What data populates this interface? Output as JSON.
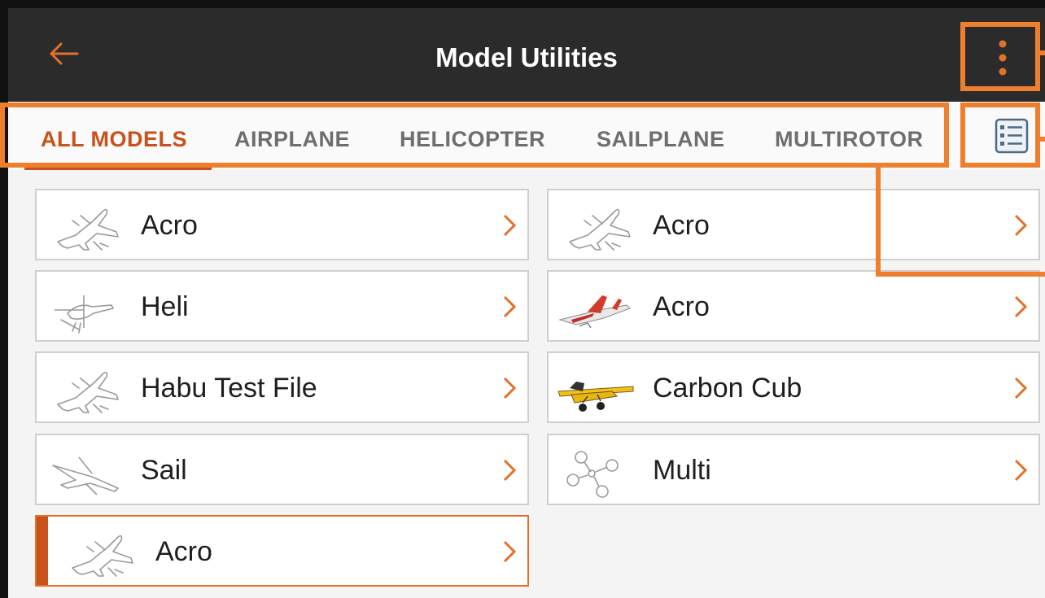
{
  "header": {
    "title": "Model Utilities",
    "back_icon": "arrow-left-icon",
    "menu_icon": "more-vertical-icon"
  },
  "tabs": [
    {
      "label": "ALL MODELS",
      "active": true
    },
    {
      "label": "AIRPLANE",
      "active": false
    },
    {
      "label": "HELICOPTER",
      "active": false
    },
    {
      "label": "SAILPLANE",
      "active": false
    },
    {
      "label": "MULTIROTOR",
      "active": false
    }
  ],
  "view_toggle_icon": "list-view-icon",
  "models": [
    {
      "name": "Acro",
      "thumbnail": "airplane-outline-icon"
    },
    {
      "name": "Acro",
      "thumbnail": "airplane-outline-icon"
    },
    {
      "name": "Heli",
      "thumbnail": "helicopter-outline-icon"
    },
    {
      "name": "Acro",
      "thumbnail": "jet-photo-thumbnail"
    },
    {
      "name": "Habu Test File",
      "thumbnail": "airplane-outline-icon"
    },
    {
      "name": "Carbon Cub",
      "thumbnail": "cub-photo-thumbnail"
    },
    {
      "name": "Sail",
      "thumbnail": "sailplane-outline-icon"
    },
    {
      "name": "Multi",
      "thumbnail": "multirotor-outline-icon"
    },
    {
      "name": "Acro",
      "thumbnail": "airplane-outline-icon",
      "selected": true
    }
  ],
  "colors": {
    "accent": "#c9521b",
    "annotation": "#f07f2d",
    "appbar_bg": "#2b2b2b",
    "tab_inactive": "#6e6e6e",
    "card_border": "#cfcfcf"
  }
}
